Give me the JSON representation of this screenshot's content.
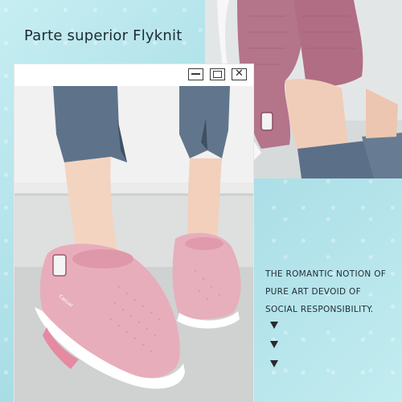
{
  "headline": "Parte superior Flyknit",
  "window": {
    "buttons": [
      "minimize-icon",
      "maximize-icon",
      "close-icon"
    ],
    "close_glyph": "✕"
  },
  "tagline": {
    "line1": "THE ROMANTIC NOTION OF",
    "line2": "PURE ART DEVOID OF",
    "line3": "SOCIAL RESPONSIBILITY."
  },
  "arrows": [
    "chevron-down-icon",
    "chevron-down-icon",
    "chevron-down-icon"
  ],
  "colors": {
    "background": "#b9e6ec",
    "shoe_pink": "#e6a9b7",
    "shoe_mauve": "#b56f86",
    "sole": "#ffffff",
    "denim": "#5b6f83"
  },
  "logo_text": "Casual"
}
